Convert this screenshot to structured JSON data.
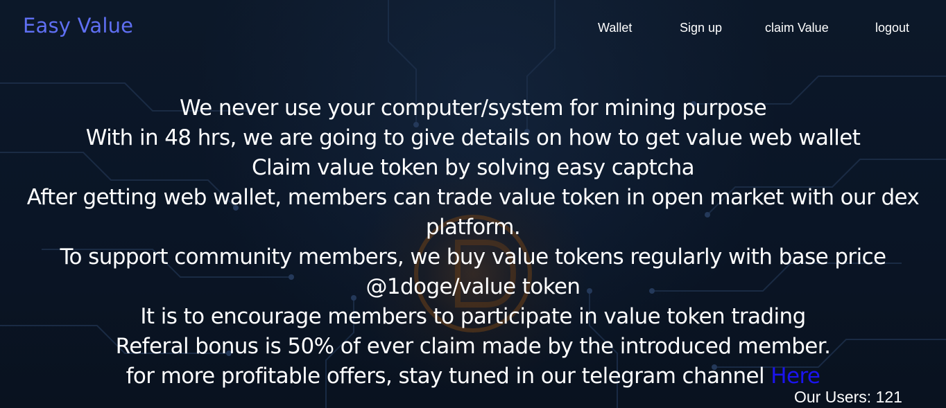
{
  "header": {
    "logo": "Easy Value",
    "nav": {
      "wallet": "Wallet",
      "signup": "Sign up",
      "claim": "claim Value",
      "logout": "logout"
    }
  },
  "main": {
    "lines": [
      "We never use your computer/system for mining purpose",
      "With in 48 hrs, we are going to give details on how to get value web wallet",
      "Claim value token by solving easy captcha",
      "After getting web wallet, members can trade value token in open market with our dex",
      "platform.",
      "To support community members, we buy value tokens regularly with base price",
      "@1doge/value token",
      "It is to encourage members to participate in value token trading",
      "Referal bonus is 50% of ever claim made by the introduced member."
    ],
    "telegram_text": "for more profitable offers, stay tuned in our telegram channel ",
    "telegram_link": "Here"
  },
  "footer": {
    "users_label": "Our Users: 121"
  },
  "colors": {
    "logo": "#5f6ff2",
    "link": "#1b14ee",
    "background": "#0a1424",
    "text": "#ffffff"
  }
}
